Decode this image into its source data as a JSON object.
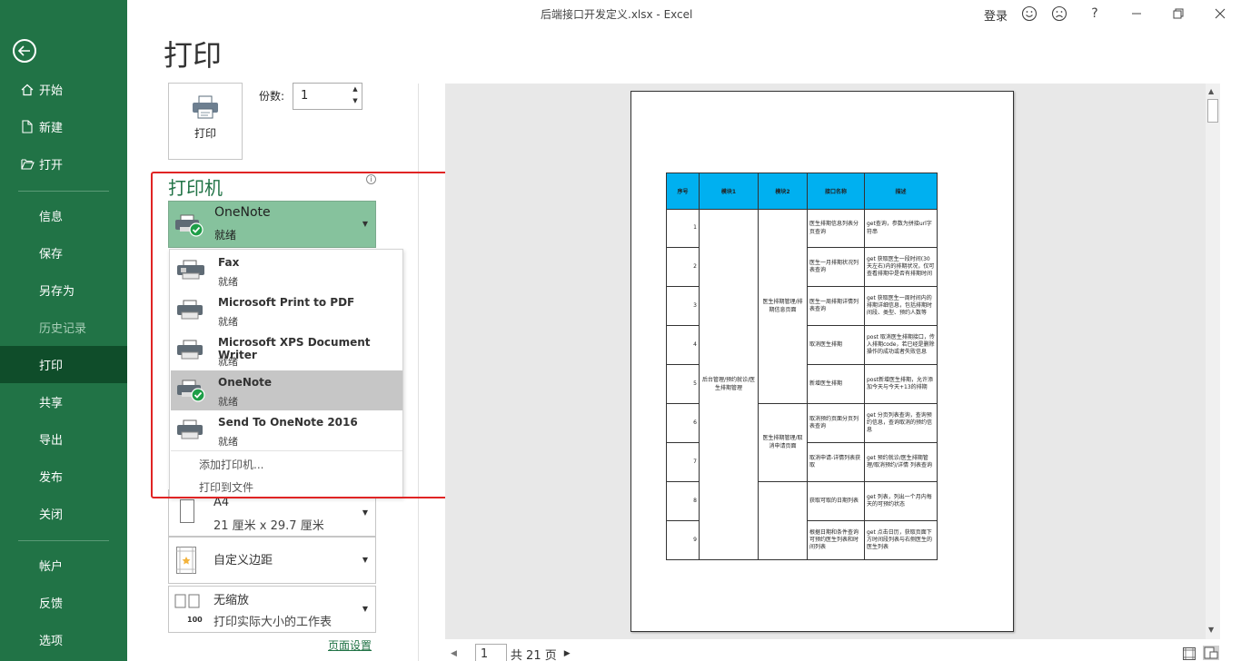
{
  "window": {
    "title": "后端接口开发定义.xlsx  -  Excel",
    "login": "登录",
    "help": "?"
  },
  "sidebar": {
    "items": [
      {
        "label": "开始"
      },
      {
        "label": "新建"
      },
      {
        "label": "打开"
      },
      {
        "label": "信息"
      },
      {
        "label": "保存"
      },
      {
        "label": "另存为"
      },
      {
        "label": "历史记录"
      },
      {
        "label": "打印"
      },
      {
        "label": "共享"
      },
      {
        "label": "导出"
      },
      {
        "label": "发布"
      },
      {
        "label": "关闭"
      },
      {
        "label": "帐户"
      },
      {
        "label": "反馈"
      },
      {
        "label": "选项"
      }
    ]
  },
  "print": {
    "heading": "打印",
    "button_label": "打印",
    "copies_label": "份数:",
    "copies_value": "1"
  },
  "printer": {
    "heading": "打印机",
    "info": "i",
    "selected": {
      "name": "OneNote",
      "status": "就绪"
    },
    "list": [
      {
        "name": "Fax",
        "status": "就绪"
      },
      {
        "name": "Microsoft Print to PDF",
        "status": "就绪"
      },
      {
        "name": "Microsoft XPS Document Writer",
        "status": "就绪"
      },
      {
        "name": "OneNote",
        "status": "就绪"
      },
      {
        "name": "Send To OneNote 2016",
        "status": "就绪"
      }
    ],
    "add_printer": "添加打印机...",
    "print_to_file": "打印到文件"
  },
  "settings": {
    "paper_label": "A4",
    "paper_size": "21 厘米 x 29.7 厘米",
    "margins": "自定义边距",
    "scaling_main": "无缩放",
    "scaling_sub": "打印实际大小的工作表",
    "scaling_icon_text": "100",
    "page_setup": "页面设置"
  },
  "preview": {
    "headers": [
      "序号",
      "模块1",
      "模块2",
      "接口名称",
      "描述"
    ],
    "rows": [
      {
        "no": "1",
        "name": "医生排期信息列表分页查询",
        "desc": "get查询，参数为拼接url字符串"
      },
      {
        "no": "2",
        "name": "医生一月排期状况列表查询",
        "desc": "get 获取医生一段时间(30天左右)内的排期状况，仅可查看排期中是否有排期时间"
      },
      {
        "no": "3",
        "name": "医生一周排期详情列表查询",
        "desc": "get 获取医生一周时间内的排期详细信息，包括排期时间段、类型、预约人数等"
      },
      {
        "no": "4",
        "name": "取消医生排期",
        "desc": "post 取消医生排期接口，传入排期code，若已经是删除操作的成功或者失败信息"
      },
      {
        "no": "5",
        "name": "新增医生排期",
        "desc": "post新增医生排期，允许添加今天与今天+13的排期"
      },
      {
        "no": "6",
        "name": "取消预约页面分页列表查询",
        "desc": "get 分页列表查询，查询预约信息，查询取消的预约信息"
      },
      {
        "no": "7",
        "name": "取消申请-详情列表获取",
        "desc": "get 预约就诊/医生排期管理/取消预约/详情 列表查询"
      },
      {
        "no": "8",
        "name": "获取可取的日期列表",
        "desc": "get 列表，列出一个月内每天的可预约状态"
      },
      {
        "no": "9",
        "name": "根据日期和条件查询可预约医生列表和时间列表",
        "desc": "get 点击日历，获取页面下方时间段列表与右侧医生的医生列表"
      }
    ],
    "module1": "后台管理/预约就诊/医生排期管理",
    "module2a": "医生排期管理/排期信息页面",
    "module2b": "医生排期管理/取消申请页面"
  },
  "pager": {
    "current": "1",
    "total": "共 21 页"
  }
}
